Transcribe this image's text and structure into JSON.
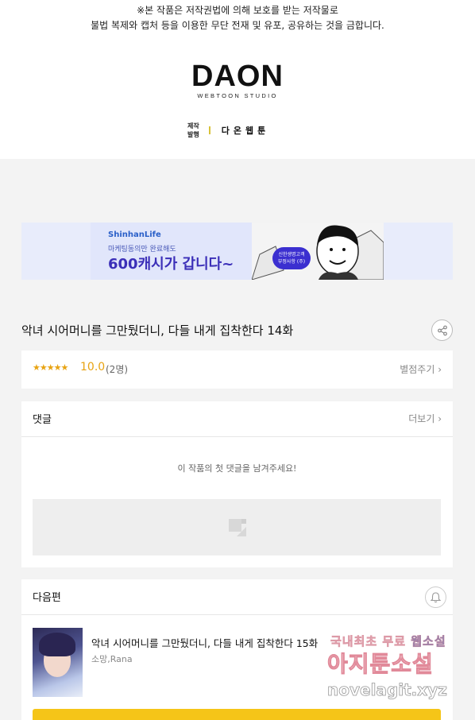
{
  "notice": {
    "line1": "※본 작품은 저작권법에 의해 보호를 받는 저작물로",
    "line2": "불법 복제와 캡처 등을 이용한 무단 전재 및 유포, 공유하는 것을 금합니다."
  },
  "studio": {
    "logo": "DAON",
    "logo_sub": "WEBTOON STUDIO",
    "roles_line1": "제작",
    "roles_line2": "발행",
    "name": "다온웹툰"
  },
  "banner": {
    "brand": "ShinhanLife",
    "small_text": "마케팅동의만 완료해도",
    "big_text": "600캐시가 갑니다~",
    "badge_line1": "신한생명고객",
    "badge_line2": "부정사항 (주)"
  },
  "episode": {
    "title": "악녀 시어머니를 그만뒀더니, 다들 내게 집착한다 14화"
  },
  "rating": {
    "stars": "★★★★★",
    "score": "10.0",
    "count": "(2명)",
    "rate_label": "별점주기 ›"
  },
  "comments": {
    "heading": "댓글",
    "more_label": "더보기 ›",
    "empty_message": "이 작품의 첫 댓글을 남겨주세요!"
  },
  "next": {
    "heading": "다음편",
    "title": "악녀 시어머니를 그만뒀더니, 다들 내게 집착한다 15화",
    "author": "소망,Rana"
  },
  "watermark": {
    "line1a": "국내최초 무료 ",
    "line1b": "웹소설",
    "line2": "아지툰소설",
    "line3": "novelagit.xyz"
  },
  "colors": {
    "accent_gold": "#e8a312",
    "cta_yellow": "#f5c518",
    "banner_purple": "#3b2fb8"
  },
  "icons": [
    "share-icon",
    "bell-icon",
    "pencil-icon",
    "chevron-right-icon"
  ]
}
